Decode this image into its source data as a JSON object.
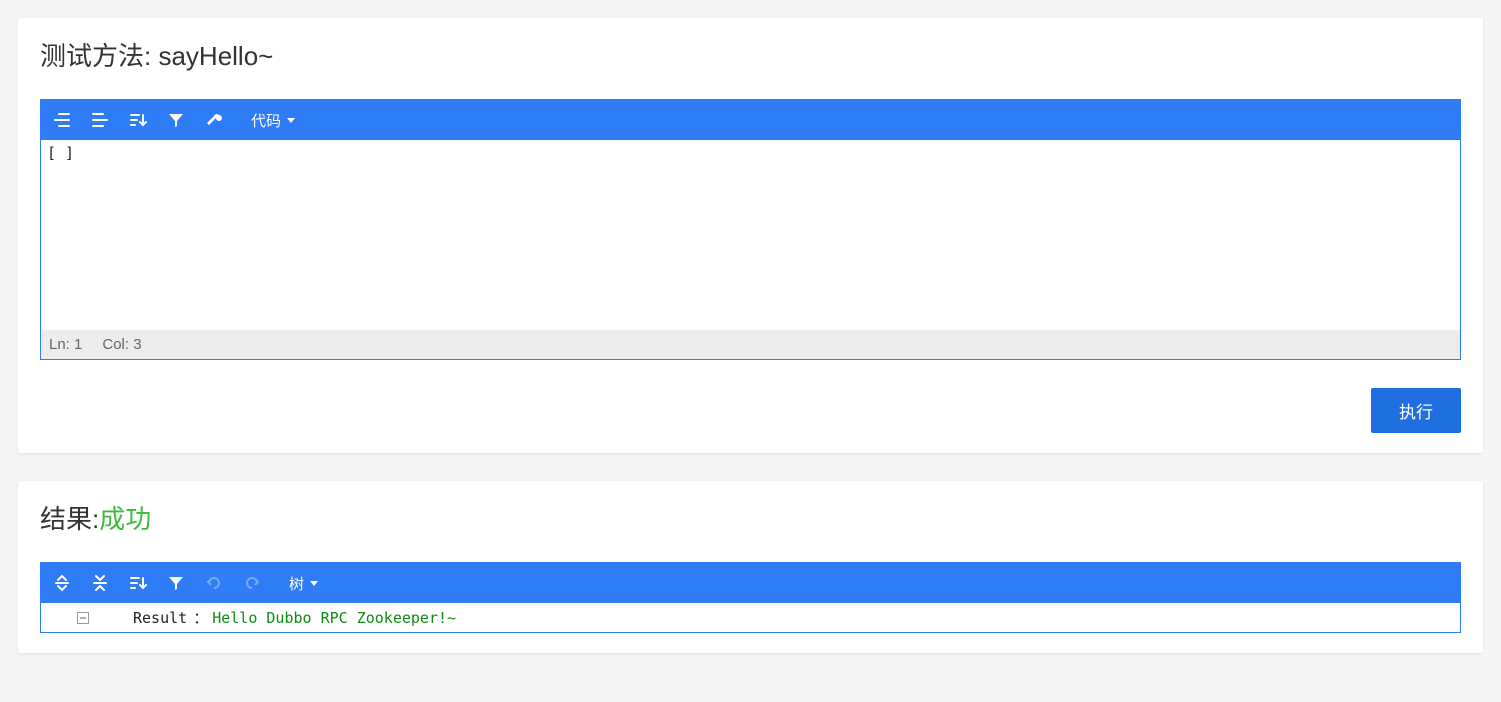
{
  "input_card": {
    "title_prefix": "测试方法: ",
    "method_name": "sayHello~",
    "toolbar": {
      "code_dropdown_label": "代码"
    },
    "editor_content": "[ ]",
    "status": {
      "line_label": "Ln: 1",
      "col_label": "Col: 3"
    },
    "execute_button_label": "执行"
  },
  "result_card": {
    "title_prefix": "结果:",
    "status_text": "成功",
    "toolbar": {
      "tree_dropdown_label": "树"
    },
    "tree": {
      "key": "Result",
      "colon": "：",
      "value": "Hello Dubbo RPC Zookeeper!~"
    }
  }
}
